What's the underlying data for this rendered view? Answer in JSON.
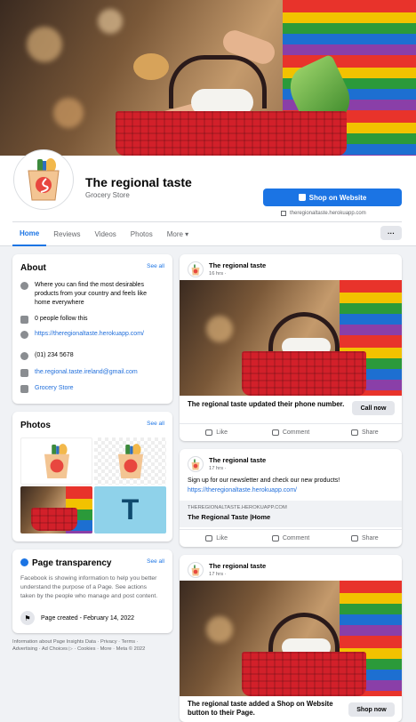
{
  "page": {
    "name": "The regional taste",
    "category": "Grocery Store",
    "shop_button": "Shop on Website",
    "site_link": "theregionaltaste.herokuapp.com",
    "tabs": [
      "Home",
      "Reviews",
      "Videos",
      "Photos",
      "More"
    ],
    "more_dots": "···"
  },
  "about": {
    "title": "About",
    "see_all": "See all",
    "description": "Where you can find the most desirables products from your country and feels like home everywhere",
    "followers": "0 people follow this",
    "website": "https://theregionaltaste.herokuapp.com/",
    "phone": "(01) 234 5678",
    "email": "the.regional.taste.ireland@gmail.com",
    "category": "Grocery Store"
  },
  "photos": {
    "title": "Photos",
    "see_all": "See all",
    "thumb_letter": "T"
  },
  "transparency": {
    "title": "Page transparency",
    "see_all": "See all",
    "text": "Facebook is showing information to help you better understand the purpose of a Page. See actions taken by the people who manage and post content.",
    "created": "Page created - February 14, 2022"
  },
  "footer": "Information about Page Insights Data · Privacy · Terms · Advertising · Ad Choices ▷ · Cookies · More · Meta © 2022",
  "posts": [
    {
      "author": "The regional taste",
      "time": "16 hrs ·",
      "caption": "The regional taste updated their phone number.",
      "button": "Call now"
    },
    {
      "author": "The regional taste",
      "time": "17 hrs ·",
      "text": "Sign up for our newsletter and check our new products!",
      "link": "https://theregionaltaste.herokuapp.com/",
      "link_domain": "THEREGIONALTASTE.HEROKUAPP.COM",
      "link_title": "The Regional Taste |Home"
    },
    {
      "author": "The regional taste",
      "time": "17 hrs ·",
      "caption": "The regional taste added a Shop on Website button to their Page.",
      "button": "Shop now"
    }
  ],
  "actions": {
    "like": "Like",
    "comment": "Comment",
    "share": "Share"
  },
  "colors": {
    "accent": "#1b74e4",
    "bg": "#f0f2f5",
    "basket": "#d2202a"
  }
}
